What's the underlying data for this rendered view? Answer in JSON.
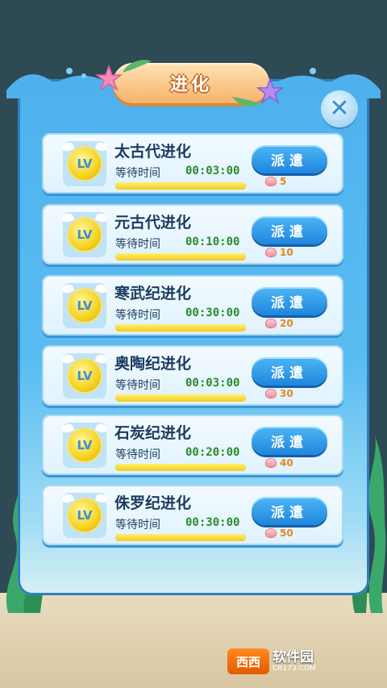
{
  "title": "进化",
  "close_icon": "close-icon",
  "button_label": "派遣",
  "wait_label": "等待时间",
  "level_badge": "LV",
  "stages": [
    {
      "name": "太古代进化",
      "time": "00:03:00",
      "cost": "5",
      "progress": 1.0
    },
    {
      "name": "元古代进化",
      "time": "00:10:00",
      "cost": "10",
      "progress": 1.0
    },
    {
      "name": "寒武纪进化",
      "time": "00:30:00",
      "cost": "20",
      "progress": 1.0
    },
    {
      "name": "奥陶纪进化",
      "time": "00:03:00",
      "cost": "30",
      "progress": 1.0
    },
    {
      "name": "石炭纪进化",
      "time": "00:20:00",
      "cost": "40",
      "progress": 1.0
    },
    {
      "name": "侏罗纪进化",
      "time": "00:30:00",
      "cost": "50",
      "progress": 1.0
    }
  ],
  "watermark": {
    "logo": "西西",
    "text": "软件园",
    "sub": "CR173.COM"
  },
  "colors": {
    "panel": "#59bdf1",
    "button": "#1f86dc",
    "time": "#2c8a2c",
    "cost": "#e08a20"
  }
}
